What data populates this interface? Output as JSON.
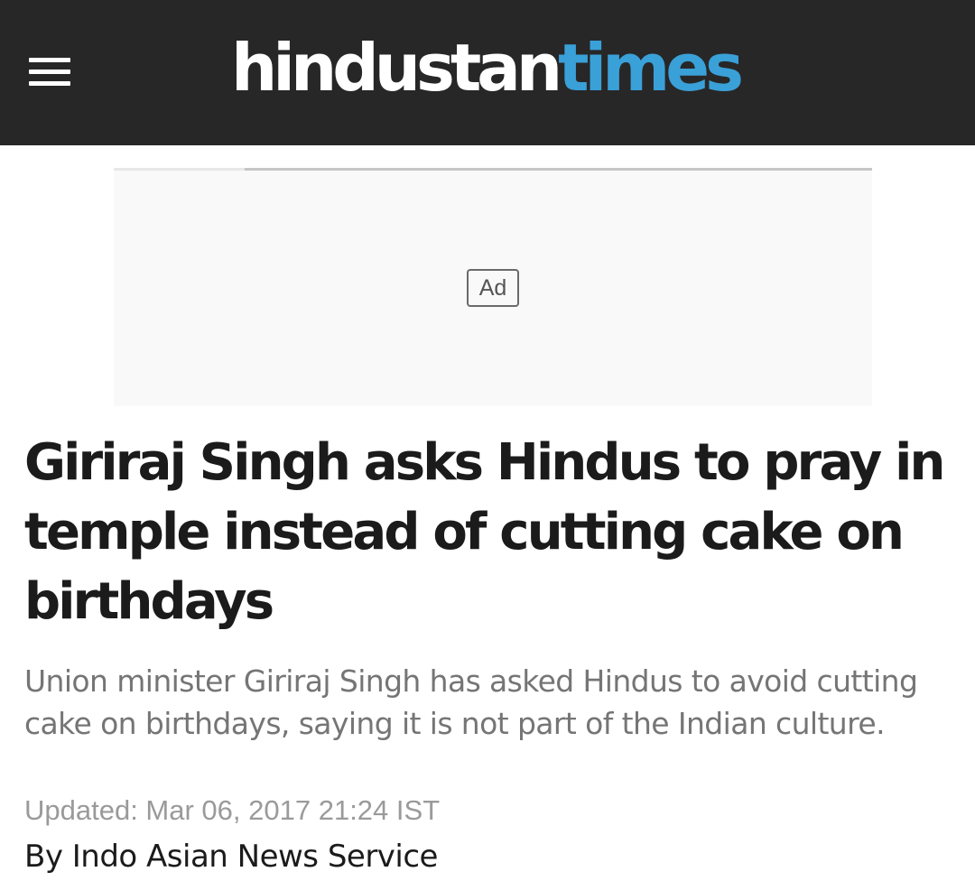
{
  "header": {
    "menu_icon": "hamburger-menu-icon",
    "logo_part1": "hindustan",
    "logo_part2": "times",
    "background_color": "#272727",
    "logo_accent_color": "#3aa0d8"
  },
  "ad": {
    "label": "Ad"
  },
  "article": {
    "headline": "Giriraj Singh asks Hindus to pray in temple instead of cutting cake on birthdays",
    "summary": "Union minister Giriraj Singh has asked Hindus to avoid cutting cake on birthdays, saying it is not part of the Indian culture.",
    "updated": "Updated: Mar 06, 2017 21:24 IST",
    "byline": "By Indo Asian News Service"
  }
}
